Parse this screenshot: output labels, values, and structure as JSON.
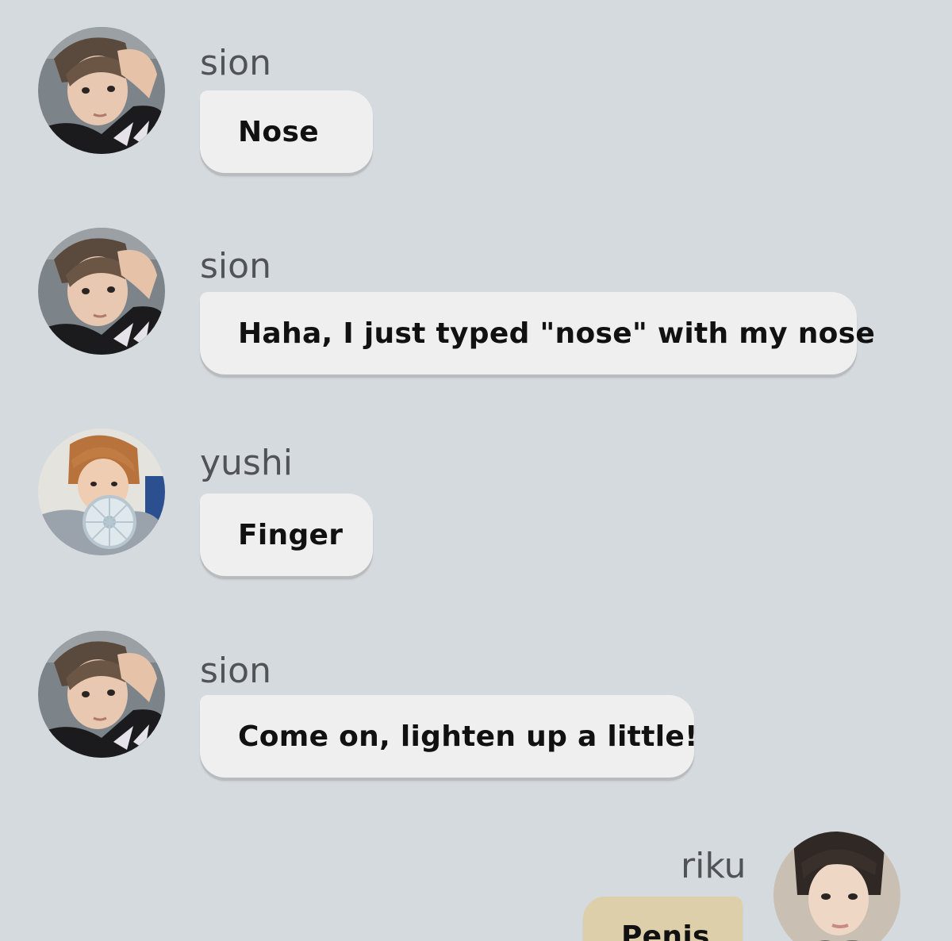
{
  "messages": [
    {
      "sender": "sion",
      "text": "Nose",
      "avatar": "sion-avatar",
      "side": "left"
    },
    {
      "sender": "sion",
      "text": "Haha, I just typed \"nose\" with my nose",
      "avatar": "sion-avatar",
      "side": "left"
    },
    {
      "sender": "yushi",
      "text": "Finger",
      "avatar": "yushi-avatar",
      "side": "left"
    },
    {
      "sender": "sion",
      "text": "Come on, lighten up a little!",
      "avatar": "sion-avatar",
      "side": "left"
    },
    {
      "sender": "riku",
      "text": "Penis",
      "avatar": "riku-avatar",
      "side": "right"
    }
  ],
  "colors": {
    "background": "#d5dade",
    "incoming_bubble": "#efefef",
    "outgoing_bubble": "#ddcfa9",
    "sender_name": "#505457",
    "message_text": "#111111"
  }
}
